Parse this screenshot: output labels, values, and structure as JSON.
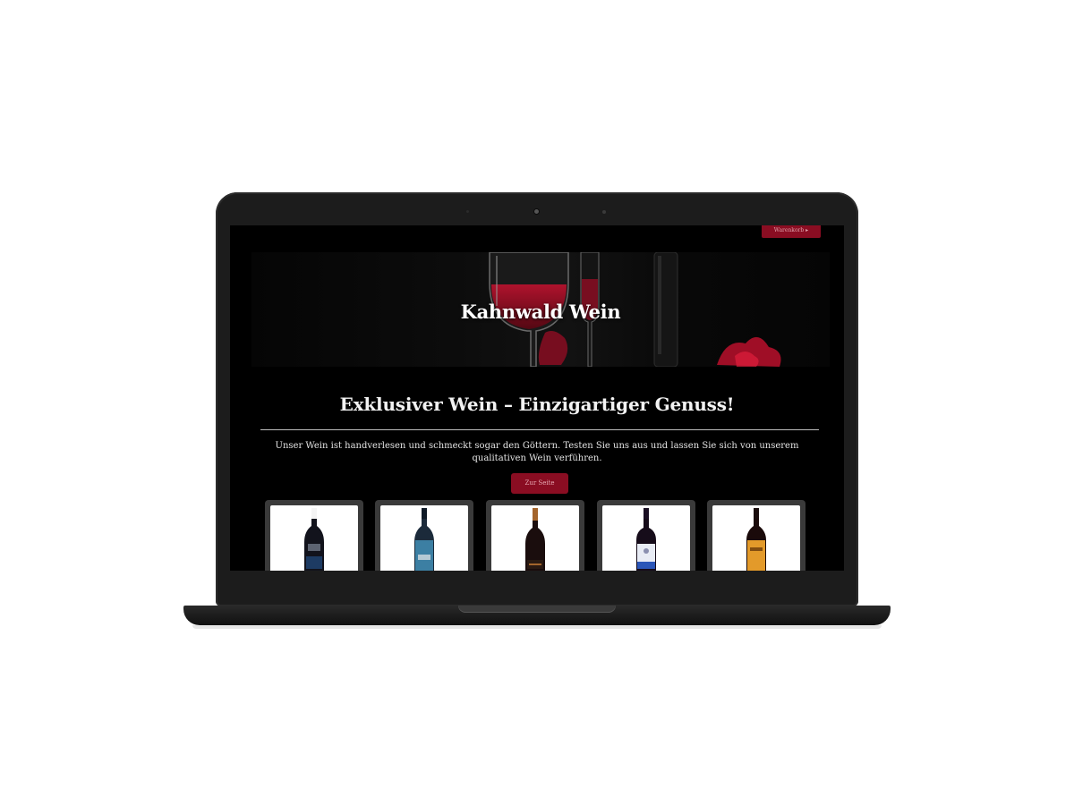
{
  "header": {
    "top_button_label": "Warenkorb ▸",
    "site_title": "Kahnwald Wein"
  },
  "main": {
    "headline": "Exklusiver Wein – Einzigartiger Genuss!",
    "intro": "Unser Wein ist handverlesen und schmeckt sogar den Göttern. Testen Sie uns aus und lassen Sie sich von unserem qualitativen Wein verführen.",
    "cta_label": "Zur Seite"
  },
  "products": [
    {
      "icon": "wine-bottle-dark-blue-label",
      "bottle_color": "#12131c",
      "capsule_color": "#f4f4f4",
      "label_color": "#1d3b63"
    },
    {
      "icon": "wine-bottle-teal-label",
      "bottle_color": "#1b2a3a",
      "capsule_color": "#0f1a27",
      "label_color": "#3c7fa3"
    },
    {
      "icon": "wine-bottle-black-gold-label",
      "bottle_color": "#1a0d0d",
      "capsule_color": "#a4652c",
      "label_color": "#2a1a12"
    },
    {
      "icon": "wine-bottle-white-blue-label",
      "bottle_color": "#160c1a",
      "capsule_color": "#1a0f23",
      "label_color": "#e8ecf5"
    },
    {
      "icon": "wine-bottle-orange-label",
      "bottle_color": "#1a0a0a",
      "capsule_color": "#1a0d0d",
      "label_color": "#e39a2a"
    }
  ],
  "colors": {
    "accent": "#8a0d22",
    "background": "#000000",
    "text": "#f2f2f2"
  }
}
